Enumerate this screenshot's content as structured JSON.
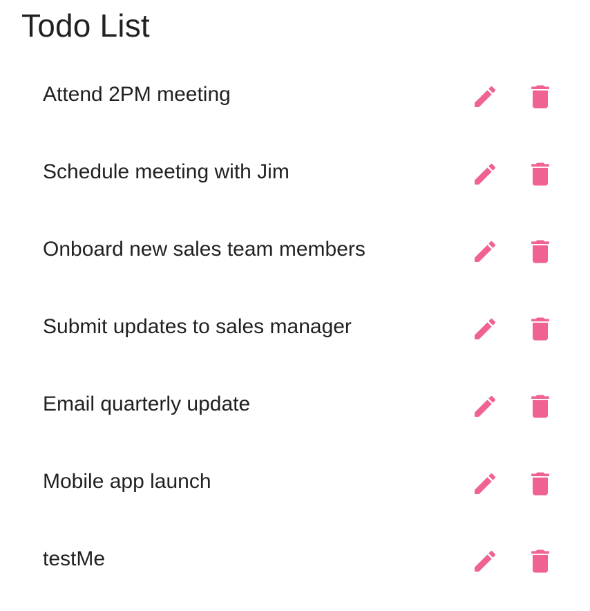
{
  "header": {
    "title": "Todo List"
  },
  "colors": {
    "accent": "#f06292",
    "text": "#212121",
    "background": "#ffffff"
  },
  "icons": {
    "edit": "pencil-icon",
    "delete": "trash-icon"
  },
  "todos": [
    {
      "text": "Attend 2PM meeting"
    },
    {
      "text": "Schedule meeting with Jim"
    },
    {
      "text": "Onboard new sales team members"
    },
    {
      "text": "Submit updates to sales manager"
    },
    {
      "text": "Email quarterly update"
    },
    {
      "text": "Mobile app launch"
    },
    {
      "text": "testMe"
    }
  ]
}
